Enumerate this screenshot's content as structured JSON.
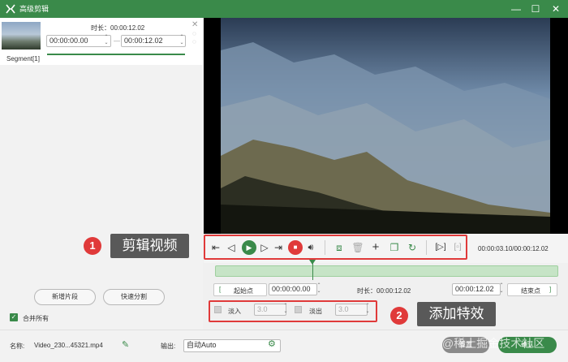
{
  "window": {
    "title": "高级剪辑",
    "minimize": "—",
    "maximize": "☐",
    "close": "✕"
  },
  "segment": {
    "duration_label": "时长：00:00:12.02",
    "start_time": "00:00:00.00",
    "end_time": "00:00:12.02",
    "label": "Segment[1]"
  },
  "left_buttons": {
    "new_segment": "新增片段",
    "quick_split": "快速分割"
  },
  "merge_all": {
    "label": "合并所有",
    "checked": true
  },
  "playback": {
    "time_readout": "00:00:03.10/00:00:12.02"
  },
  "trim": {
    "start_label": "起始点",
    "start_time": "00:00:00.00",
    "duration": "时长：00:00:12.02",
    "end_time": "00:00:12.02",
    "end_label": "结束点",
    "bracket_left": "[",
    "bracket_right": "]"
  },
  "effects": {
    "fade_in_label": "淡入",
    "fade_in_value": "3.0",
    "fade_out_label": "淡出",
    "fade_out_value": "3.0"
  },
  "callouts": [
    {
      "number": "1",
      "text": "剪辑视频"
    },
    {
      "number": "2",
      "text": "添加特效"
    }
  ],
  "bottom": {
    "name_label": "名称:",
    "file_name": "Video_230...45321.mp4",
    "output_label": "输出:",
    "output_value": "自动Auto",
    "reset_button": "重置",
    "ok_button": "确认",
    "watermark": "@稀土掘金技术社区"
  },
  "colors": {
    "accent": "#3a8a4a",
    "highlight": "#e03a3a"
  }
}
